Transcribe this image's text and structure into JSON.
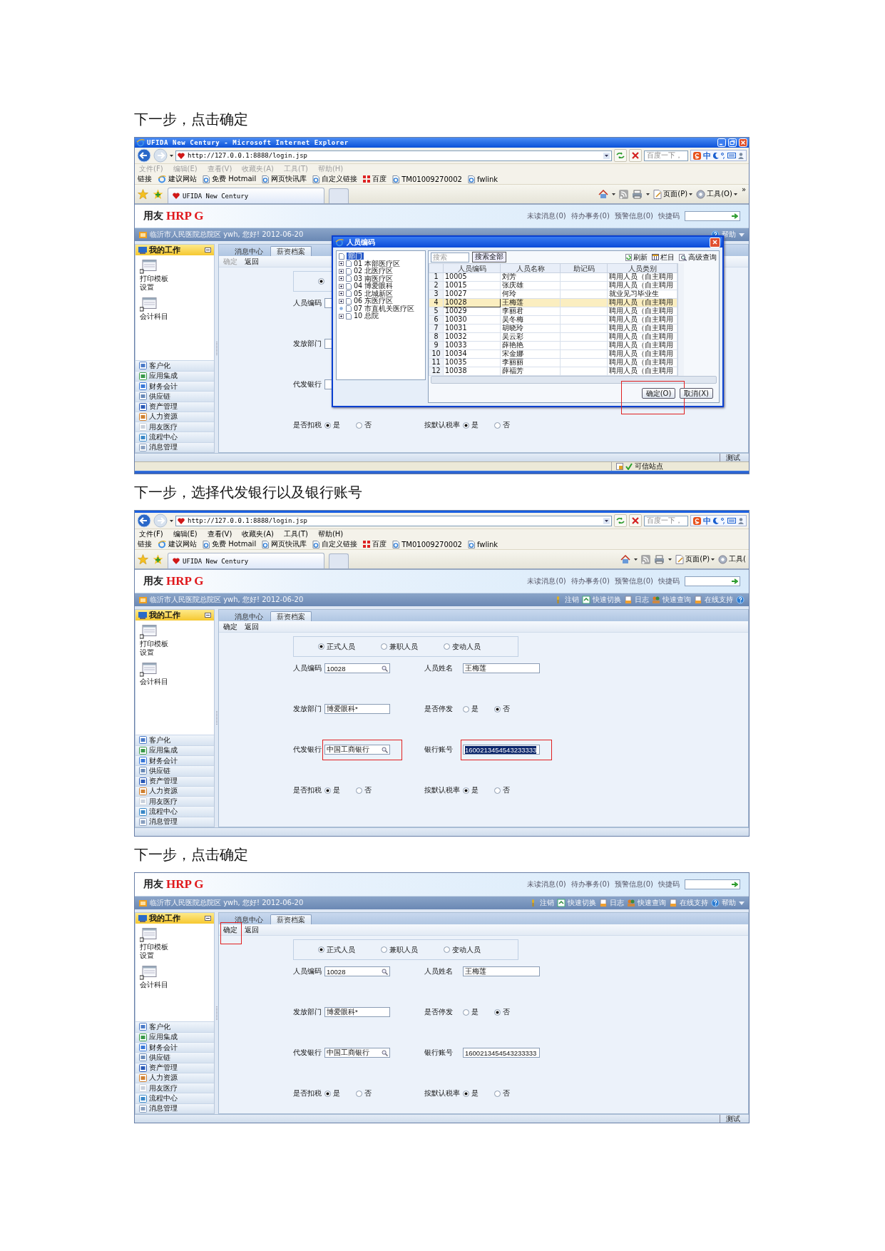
{
  "steps": [
    {
      "heading": "下一步，点击确定",
      "browser": {
        "title": "UFIDA New Century - Microsoft Internet Explorer",
        "url": "http://127.0.0.1:8888/login.jsp",
        "search_placeholder": "百度一下，",
        "ime": "中",
        "menu_disabled": true,
        "menu": [
          "文件(F)",
          "编辑(E)",
          "查看(V)",
          "收藏夹(A)",
          "工具(T)",
          "帮助(H)"
        ],
        "links_label": "链接",
        "links": [
          "建议网站",
          "免费 Hotmail",
          "网页快讯库",
          "自定义链接",
          "百度",
          "TM01009270002",
          "fwlink"
        ],
        "tab": "UFIDA New Century",
        "commands": [
          "页面(P)",
          "工具(O)"
        ],
        "overflow_mark": "»",
        "status": "可信站点"
      },
      "app": {
        "logo_text": "用友",
        "logo_brand": "HRP G",
        "quick_links": [
          "未读消息(0)",
          "待办事务(0)",
          "预警信息(0)"
        ],
        "quick_code_label": "快捷码",
        "welcome": "临沂市人民医院总院区 ywh, 您好! 2012-06-20",
        "nav_caret": true,
        "nav": [
          {
            "kind": "help",
            "label": "帮助"
          }
        ],
        "sidebar": {
          "title": "我的工作",
          "shortcuts": [
            "打印模板设置",
            "会计科目"
          ],
          "modules": [
            "客户化",
            "应用集成",
            "财务会计",
            "供应链",
            "资产管理",
            "人力资源",
            "用友医疗",
            "流程中心",
            "消息管理"
          ]
        },
        "tabs": [
          {
            "label": "消息中心",
            "selected": false
          },
          {
            "label": "薪资档案",
            "selected": true
          }
        ],
        "toolbar": [
          {
            "label": "确定",
            "disabled": true,
            "highlighted": false
          },
          {
            "label": "返回",
            "disabled": false,
            "highlighted": false
          }
        ],
        "form": {
          "rows": [
            {
              "kind": "group",
              "options": [
                {
                  "selected": true
                }
              ]
            },
            {
              "kind": "pair",
              "cells": [
                {
                  "label": "人员编码",
                  "kind": "text"
                }
              ]
            },
            {
              "kind": "pair",
              "cells": [
                {
                  "label": "发放部门",
                  "kind": "text"
                }
              ]
            },
            {
              "kind": "pair",
              "cells": [
                {
                  "label": "代发银行",
                  "kind": "text"
                }
              ]
            },
            {
              "kind": "pair",
              "cells": [
                {
                  "label": "是否扣税",
                  "kind": "radio",
                  "options": [
                    {
                      "label": "是",
                      "selected": true
                    },
                    {
                      "label": "否",
                      "selected": false
                    }
                  ]
                },
                {
                  "label": "按默认税率",
                  "kind": "radio",
                  "options": [
                    {
                      "label": "是",
                      "selected": true
                    },
                    {
                      "label": "否",
                      "selected": false
                    }
                  ]
                }
              ]
            }
          ]
        },
        "status": "测试",
        "dialog": {
          "title": "人员编码",
          "tree": {
            "label": "部门",
            "selected": true,
            "children": [
              {
                "label": "01 本部医疗区",
                "expandable": true
              },
              {
                "label": "02 北医疗区",
                "expandable": true
              },
              {
                "label": "03 南医疗区",
                "expandable": true
              },
              {
                "label": "04 博爱眼科",
                "expandable": true
              },
              {
                "label": "05 北城新区",
                "expandable": true
              },
              {
                "label": "06 东医疗区",
                "expandable": true
              },
              {
                "label": "07 市直机关医疗区",
                "expandable": false
              },
              {
                "label": "10 总院",
                "expandable": true
              }
            ]
          },
          "search_placeholder": "搜索",
          "search_button": "搜索全部",
          "tools": [
            "刷新",
            "栏目",
            "高级查询"
          ],
          "columns": [
            "人员编码",
            "人员名称",
            "助记码",
            "人员类别"
          ],
          "rows": [
            {
              "no": "1",
              "code": "10005",
              "name": "刘芳",
              "category": "聘用人员（自主聘用",
              "selected": false
            },
            {
              "no": "2",
              "code": "10015",
              "name": "张庆雄",
              "category": "聘用人员（自主聘用",
              "selected": false
            },
            {
              "no": "3",
              "code": "10027",
              "name": "何玲",
              "category": "就业见习毕业生",
              "selected": false
            },
            {
              "no": "4",
              "code": "10028",
              "name": "王梅莲",
              "category": "聘用人员（自主聘用",
              "selected": true
            },
            {
              "no": "5",
              "code": "10029",
              "name": "李丽君",
              "category": "聘用人员（自主聘用",
              "selected": false
            },
            {
              "no": "6",
              "code": "10030",
              "name": "吴冬梅",
              "category": "聘用人员（自主聘用",
              "selected": false
            },
            {
              "no": "7",
              "code": "10031",
              "name": "胡晓玲",
              "category": "聘用人员（自主聘用",
              "selected": false
            },
            {
              "no": "8",
              "code": "10032",
              "name": "吴云彩",
              "category": "聘用人员（自主聘用",
              "selected": false
            },
            {
              "no": "9",
              "code": "10033",
              "name": "薛艳艳",
              "category": "聘用人员（自主聘用",
              "selected": false
            },
            {
              "no": "10",
              "code": "10034",
              "name": "宋金娜",
              "category": "聘用人员（自主聘用",
              "selected": false
            },
            {
              "no": "11",
              "code": "10035",
              "name": "李丽丽",
              "category": "聘用人员（自主聘用",
              "selected": false
            },
            {
              "no": "12",
              "code": "10038",
              "name": "薛福芳",
              "category": "聘用人员（自主聘用",
              "selected": false
            }
          ],
          "buttons": [
            {
              "label": "确定(O)",
              "highlighted": true
            },
            {
              "label": "取消(X)",
              "highlighted": false
            }
          ]
        }
      }
    },
    {
      "heading": "下一步，选择代发银行以及银行账号",
      "browser": {
        "url": "http://127.0.0.1:8888/login.jsp",
        "search_placeholder": "百度一下，",
        "ime": "中",
        "menu_disabled": false,
        "menu": [
          "文件(F)",
          "编辑(E)",
          "查看(V)",
          "收藏夹(A)",
          "工具(T)",
          "帮助(H)"
        ],
        "links_label": "链接",
        "links": [
          "建议网站",
          "免费 Hotmail",
          "网页快讯库",
          "自定义链接",
          "百度",
          "TM01009270002",
          "fwlink"
        ],
        "tab": "UFIDA New Century",
        "commands": [
          "页面(P)",
          "工具("
        ]
      },
      "app": {
        "logo_text": "用友",
        "logo_brand": "HRP G",
        "quick_links": [
          "未读消息(0)",
          "待办事务(0)",
          "预警信息(0)"
        ],
        "quick_code_label": "快捷码",
        "welcome": "临沂市人民医院总院区 ywh, 您好! 2012-06-20",
        "nav_caret": false,
        "nav": [
          {
            "kind": "logout",
            "label": "注销"
          },
          {
            "kind": "switch",
            "label": "快速切换"
          },
          {
            "kind": "log",
            "label": "日志"
          },
          {
            "kind": "query",
            "label": "快速查询"
          },
          {
            "kind": "support",
            "label": "在线支持"
          },
          {
            "kind": "help"
          }
        ],
        "sidebar": {
          "title": "我的工作",
          "shortcuts": [
            "打印模板设置",
            "会计科目"
          ],
          "modules": [
            "客户化",
            "应用集成",
            "财务会计",
            "供应链",
            "资产管理",
            "人力资源",
            "用友医疗",
            "流程中心",
            "消息管理"
          ]
        },
        "tabs": [
          {
            "label": "消息中心",
            "selected": false
          },
          {
            "label": "薪资档案",
            "selected": true
          }
        ],
        "toolbar": [
          {
            "label": "确定",
            "disabled": false,
            "highlighted": false
          },
          {
            "label": "返回",
            "disabled": false,
            "highlighted": false
          }
        ],
        "form": {
          "rows": [
            {
              "kind": "group",
              "options": [
                {
                  "label": "正式人员",
                  "selected": true
                },
                {
                  "label": "兼职人员",
                  "selected": false
                },
                {
                  "label": "变动人员",
                  "selected": false
                }
              ]
            },
            {
              "kind": "pair",
              "cells": [
                {
                  "label": "人员编码",
                  "kind": "lookup",
                  "value": "10028"
                },
                {
                  "label": "人员姓名",
                  "kind": "text",
                  "value": "王梅莲"
                }
              ]
            },
            {
              "kind": "pair",
              "cells": [
                {
                  "label": "发放部门",
                  "kind": "text",
                  "value": "博爱眼科*"
                },
                {
                  "label": "是否停发",
                  "kind": "radio",
                  "options": [
                    {
                      "label": "是",
                      "selected": false
                    },
                    {
                      "label": "否",
                      "selected": true
                    }
                  ]
                }
              ]
            },
            {
              "kind": "pair",
              "cells": [
                {
                  "label": "代发银行",
                  "kind": "lookup",
                  "value": "中国工商银行",
                  "highlighted": true
                },
                {
                  "label": "银行账号",
                  "kind": "text",
                  "value": "1600213454543233333",
                  "highlighted": true,
                  "value_selected": true
                }
              ]
            },
            {
              "kind": "pair",
              "cells": [
                {
                  "label": "是否扣税",
                  "kind": "radio",
                  "options": [
                    {
                      "label": "是",
                      "selected": true
                    },
                    {
                      "label": "否",
                      "selected": false
                    }
                  ]
                },
                {
                  "label": "按默认税率",
                  "kind": "radio",
                  "options": [
                    {
                      "label": "是",
                      "selected": true
                    },
                    {
                      "label": "否",
                      "selected": false
                    }
                  ]
                }
              ]
            }
          ]
        }
      }
    },
    {
      "heading": "下一步，点击确定",
      "app": {
        "logo_text": "用友",
        "logo_brand": "HRP G",
        "quick_links": [
          "未读消息(0)",
          "待办事务(0)",
          "预警信息(0)"
        ],
        "quick_code_label": "快捷码",
        "welcome": "临沂市人民医院总院区 ywh, 您好! 2012-06-20",
        "nav_caret": true,
        "nav": [
          {
            "kind": "logout",
            "label": "注销"
          },
          {
            "kind": "switch",
            "label": "快速切换"
          },
          {
            "kind": "log",
            "label": "日志"
          },
          {
            "kind": "query",
            "label": "快速查询"
          },
          {
            "kind": "support",
            "label": "在线支持"
          },
          {
            "kind": "help",
            "label": "帮助"
          }
        ],
        "sidebar": {
          "title": "我的工作",
          "shortcuts": [
            "打印模板设置",
            "会计科目"
          ],
          "modules": [
            "客户化",
            "应用集成",
            "财务会计",
            "供应链",
            "资产管理",
            "人力资源",
            "用友医疗",
            "流程中心",
            "消息管理"
          ]
        },
        "tabs": [
          {
            "label": "消息中心",
            "selected": false
          },
          {
            "label": "薪资档案",
            "selected": true
          }
        ],
        "toolbar": [
          {
            "label": "确定",
            "disabled": false,
            "highlighted": true
          },
          {
            "label": "返回",
            "disabled": false,
            "highlighted": false
          }
        ],
        "form": {
          "rows": [
            {
              "kind": "group",
              "options": [
                {
                  "label": "正式人员",
                  "selected": true
                },
                {
                  "label": "兼职人员",
                  "selected": false
                },
                {
                  "label": "变动人员",
                  "selected": false
                }
              ]
            },
            {
              "kind": "pair",
              "cells": [
                {
                  "label": "人员编码",
                  "kind": "lookup",
                  "value": "10028"
                },
                {
                  "label": "人员姓名",
                  "kind": "text",
                  "value": "王梅莲"
                }
              ]
            },
            {
              "kind": "pair",
              "cells": [
                {
                  "label": "发放部门",
                  "kind": "text",
                  "value": "博爱眼科*"
                },
                {
                  "label": "是否停发",
                  "kind": "radio",
                  "options": [
                    {
                      "label": "是",
                      "selected": false
                    },
                    {
                      "label": "否",
                      "selected": true
                    }
                  ]
                }
              ]
            },
            {
              "kind": "pair",
              "cells": [
                {
                  "label": "代发银行",
                  "kind": "lookup",
                  "value": "中国工商银行"
                },
                {
                  "label": "银行账号",
                  "kind": "text",
                  "value": "1600213454543233333"
                }
              ]
            },
            {
              "kind": "pair",
              "cells": [
                {
                  "label": "是否扣税",
                  "kind": "radio",
                  "options": [
                    {
                      "label": "是",
                      "selected": true
                    },
                    {
                      "label": "否",
                      "selected": false
                    }
                  ]
                },
                {
                  "label": "按默认税率",
                  "kind": "radio",
                  "options": [
                    {
                      "label": "是",
                      "selected": true
                    },
                    {
                      "label": "否",
                      "selected": false
                    }
                  ]
                }
              ]
            }
          ]
        },
        "status": "测试"
      }
    }
  ]
}
